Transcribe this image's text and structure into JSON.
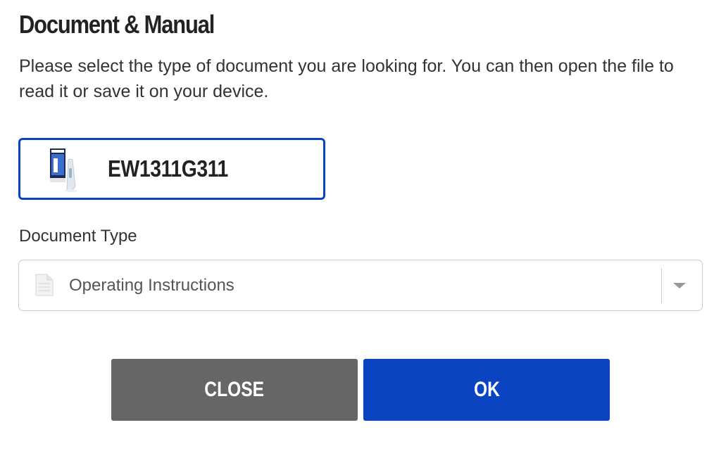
{
  "dialog": {
    "title": "Document & Manual",
    "description": "Please select the type of document you are looking for. You can then open the file to read it or save it on your device."
  },
  "product": {
    "model": "EW1311G311",
    "thumbnail_icon": "product-box-icon"
  },
  "document_type": {
    "label": "Document Type",
    "selected": "Operating Instructions",
    "icon": "document-icon"
  },
  "buttons": {
    "close_label": "CLOSE",
    "ok_label": "OK"
  },
  "colors": {
    "accent": "#0b44c0",
    "close_button": "#666666",
    "text": "#222222"
  }
}
